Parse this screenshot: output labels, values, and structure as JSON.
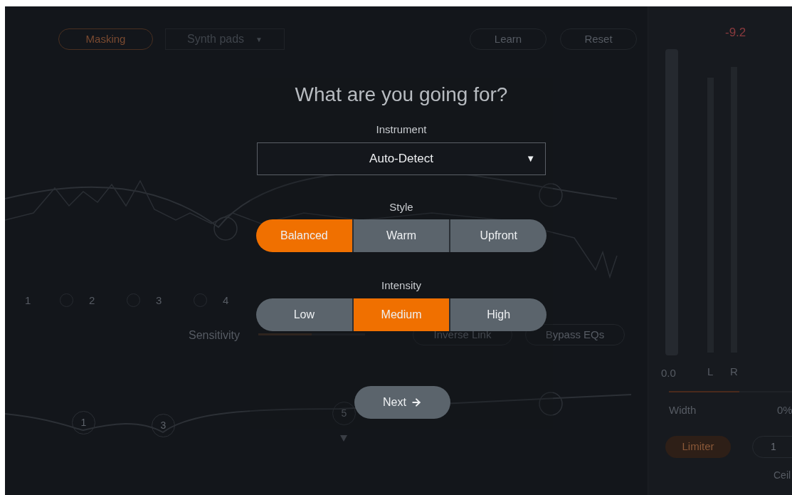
{
  "background": {
    "mode_button": {
      "label": "Masking"
    },
    "preset_dropdown": {
      "value": "Synth pads",
      "arrow": "▼"
    },
    "learn_button": {
      "label": "Learn"
    },
    "reset_button": {
      "label": "Reset"
    },
    "peak_reading": "-9.2",
    "band_labels": [
      "1",
      "2",
      "3",
      "4"
    ],
    "sensitivity": {
      "label": "Sensitivity",
      "level": 0.5
    },
    "inverse_link_button": {
      "label": "Inverse Link"
    },
    "bypass_button": {
      "label": "Bypass EQs"
    },
    "nodes": [
      "1",
      "3",
      "5"
    ],
    "meter": {
      "reading": "0.0",
      "channels": [
        "L",
        "R"
      ]
    },
    "width": {
      "label": "Width",
      "reading": "0%",
      "level": 0.55
    },
    "limiter_button": {
      "label": "Limiter"
    },
    "ceiling": {
      "value": "1",
      "label": "Ceil"
    }
  },
  "dialog": {
    "title": "What are you going for?",
    "instrument": {
      "label": "Instrument",
      "value": "Auto-Detect",
      "arrow": "▼"
    },
    "style": {
      "label": "Style",
      "options": [
        {
          "label": "Balanced",
          "selected": true
        },
        {
          "label": "Warm",
          "selected": false
        },
        {
          "label": "Upfront",
          "selected": false
        }
      ]
    },
    "intensity": {
      "label": "Intensity",
      "options": [
        {
          "label": "Low",
          "selected": false
        },
        {
          "label": "Medium",
          "selected": true
        },
        {
          "label": "High",
          "selected": false
        }
      ]
    },
    "next_button": {
      "label": "Next"
    }
  }
}
